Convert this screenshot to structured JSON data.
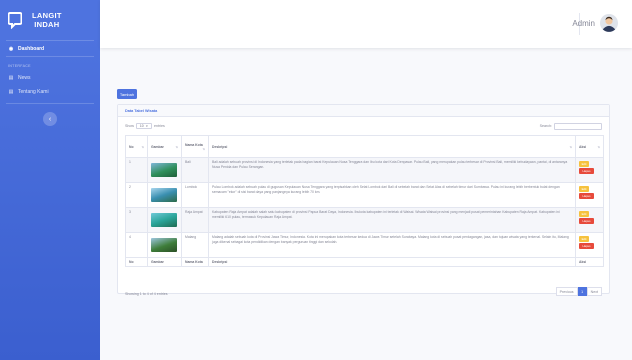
{
  "sidebar": {
    "brand": {
      "line1": "LANGIT",
      "line2": "INDAH",
      "logo_icon": "speech-bubble-icon"
    },
    "dashboard_label": "Dashboard",
    "heading": "INTERFACE",
    "items": [
      {
        "label": "News",
        "icon": "newspaper-icon"
      },
      {
        "label": "Tentang Kami",
        "icon": "info-icon"
      }
    ],
    "toggle_icon": "chevron-left-icon"
  },
  "topbar": {
    "user_name": "Admin",
    "avatar_icon": "user-avatar-icon"
  },
  "content": {
    "add_label": "Tambah",
    "card_title": "Data Tabel Wisata",
    "show_label": "Show",
    "entries_value": "10",
    "entries_label": "entries",
    "search_label": "Search:",
    "columns": [
      "No",
      "Gambar",
      "Nama Kota",
      "Deskripsi",
      "Aksi"
    ],
    "rows": [
      {
        "no": "1",
        "kota": "Bali",
        "deskripsi": "Bali adalah sebuah provinsi di Indonesia yang terletak pada bagian barat Kepulauan Nusa Tenggara dan Ibu kota dari Kota Denpasar. Pulau Bali, yang merupakan pulau terbesar di Provinsi Bali, memiliki kebudayaan, pantai, di antaranya Nusa Penida dan Pulau Serangan.",
        "thumb_color": "#2f8f5b"
      },
      {
        "no": "2",
        "kota": "Lombok",
        "deskripsi": "Pulau Lombok adalah sebuah pulau di gugusan Kepulauan Nusa Tenggara yang terpisahkan oleh Selat Lombok dari Bali di sebelah barat dan Selat Alas di sebelah timur dari Sumbawa. Pulau ini kurang lebih berbentuk bulat dengan semacam \"ekor\" di sisi barat daya yang panjangnya kurang lebih 70 km.",
        "thumb_color": "#3a8fb0"
      },
      {
        "no": "3",
        "kota": "Raja Ampat",
        "deskripsi": "Kabupaten Raja Ampat adalah salah satu kabupaten di provinsi Papua Barat Daya, Indonesia. Ibukota kabupaten ini terletak di Waisai. Wisata Waisai provinsi yang menjadi pusat pemerintahan Kabupaten Raja Ampat. Kabupaten ini memiliki 610 pulau, termasuk Kepulauan Raja Ampat.",
        "thumb_color": "#2aa59a"
      },
      {
        "no": "4",
        "kota": "Malang",
        "deskripsi": "Malang adalah sebuah kota di Provinsi Jawa Timur, Indonesia. Kota ini merupakan kota terbesar kedua di Jawa Timur setelah Surabaya. Malang kota di sebuah pusat perdagangan, jasa, dan tujuan wisata yang terkenal. Selain itu, Malang juga dikenal sebagai kota pendidikan dengan banyak perguruan tinggi dan sekolah.",
        "thumb_color": "#3e7d3a"
      }
    ],
    "edit_label": "Edit",
    "hapus_label": "Hapus",
    "info_text": "Showing 1 to 4 of 4 entries",
    "pagination": {
      "previous": "Previous",
      "current": "1",
      "next": "Next"
    }
  }
}
